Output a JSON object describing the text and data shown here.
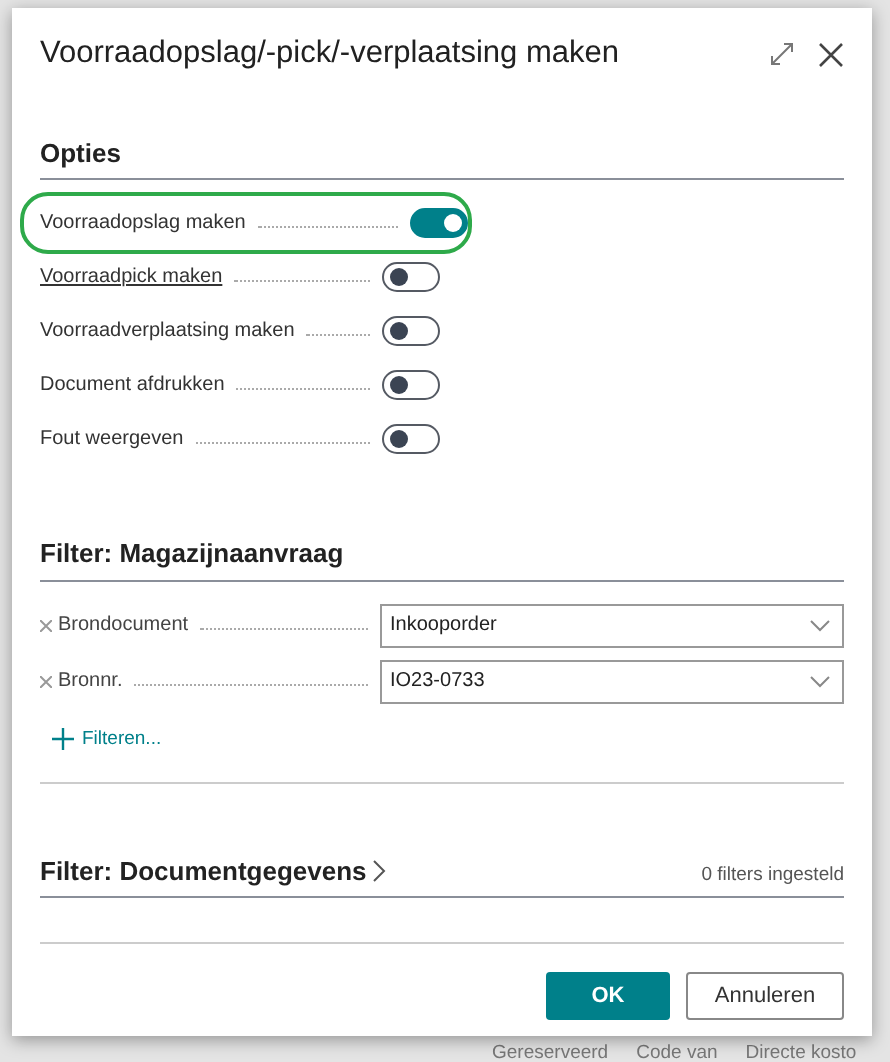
{
  "dialog": {
    "title": "Voorraadopslag/-pick/-verplaatsing maken"
  },
  "options": {
    "heading": "Opties",
    "items": [
      {
        "label": "Voorraadopslag maken",
        "on": true,
        "highlighted": true,
        "underlined": false
      },
      {
        "label": "Voorraadpick maken",
        "on": false,
        "highlighted": false,
        "underlined": true
      },
      {
        "label": "Voorraadverplaatsing maken",
        "on": false,
        "highlighted": false,
        "underlined": false
      },
      {
        "label": "Document afdrukken",
        "on": false,
        "highlighted": false,
        "underlined": false
      },
      {
        "label": "Fout weergeven",
        "on": false,
        "highlighted": false,
        "underlined": false
      }
    ]
  },
  "filter_request": {
    "heading": "Filter: Magazijnaanvraag",
    "filters": [
      {
        "label": "Brondocument",
        "value": "Inkooporder"
      },
      {
        "label": "Bronnr.",
        "value": "IO23-0733"
      }
    ],
    "add_filter": "Filteren..."
  },
  "filter_document": {
    "heading": "Filter: Documentgegevens",
    "count": "0 filters ingesteld"
  },
  "buttons": [
    {
      "label": "OK",
      "kind": "primary"
    },
    {
      "label": "Annuleren",
      "kind": "secondary"
    }
  ],
  "background_columns": [
    "Gereserveerd",
    "Code van",
    "Directe kosto"
  ]
}
